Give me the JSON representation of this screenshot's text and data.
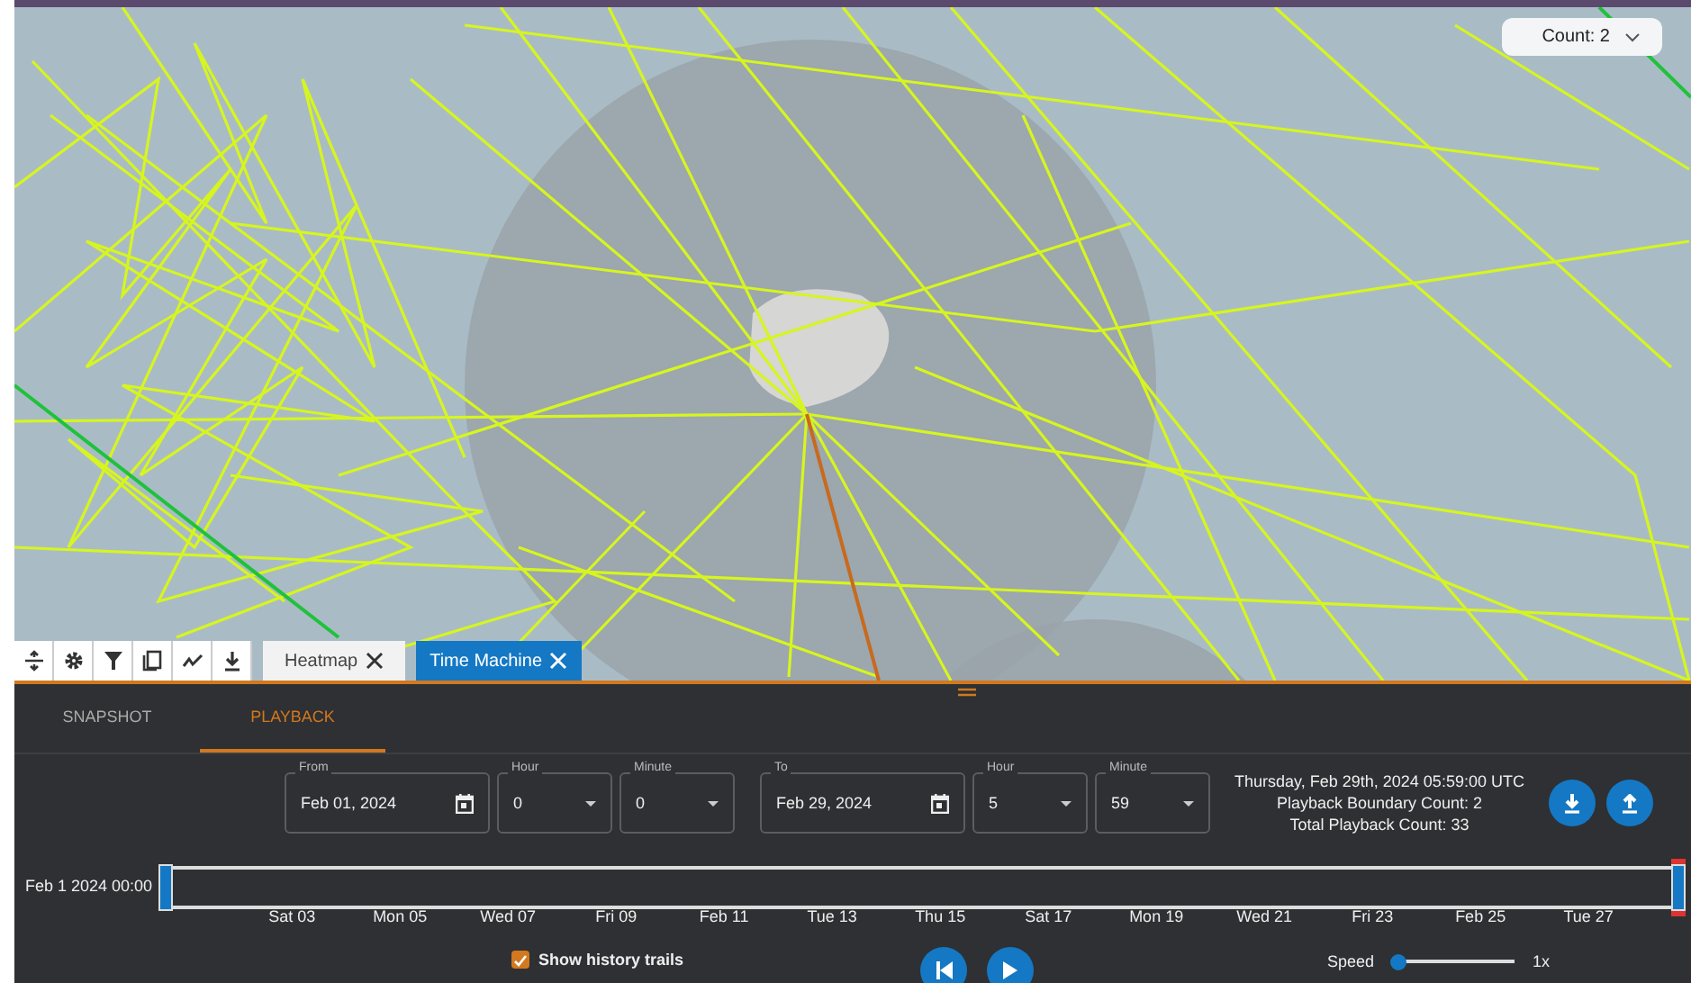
{
  "count_dropdown": {
    "label": "Count: 2"
  },
  "toolbar": {
    "tabs": [
      {
        "label": "Heatmap",
        "selected": false
      },
      {
        "label": "Time Machine",
        "selected": true
      }
    ]
  },
  "panel": {
    "tabs": [
      {
        "label": "SNAPSHOT",
        "selected": false
      },
      {
        "label": "PLAYBACK",
        "selected": true
      }
    ],
    "fields": [
      {
        "kind": "date",
        "label": "From",
        "value": "Feb 01, 2024"
      },
      {
        "kind": "select",
        "label": "Hour",
        "value": "0"
      },
      {
        "kind": "select",
        "label": "Minute",
        "value": "0"
      },
      {
        "kind": "date",
        "label": "To",
        "value": "Feb 29, 2024"
      },
      {
        "kind": "select",
        "label": "Hour",
        "value": "5"
      },
      {
        "kind": "select",
        "label": "Minute",
        "value": "59"
      }
    ],
    "summary": [
      "Thursday, Feb 29th, 2024 05:59:00 UTC",
      "Playback Boundary Count:  2",
      "Total Playback Count:  33"
    ],
    "timeline": {
      "start_label": "Feb 1 2024 00:00",
      "start": {
        "level": 0
      },
      "end": {
        "level": 1
      },
      "ticks": [
        "Sat 03",
        "Mon 05",
        "Wed 07",
        "Fri 09",
        "Feb 11",
        "Tue 13",
        "Thu 15",
        "Sat 17",
        "Mon 19",
        "Wed 21",
        "Fri 23",
        "Feb 25",
        "Tue 27"
      ]
    },
    "history_trails": {
      "label": "Show history trails",
      "checked": true
    },
    "speed": {
      "label": "Speed",
      "level": 0.05,
      "reading": "1x"
    }
  }
}
